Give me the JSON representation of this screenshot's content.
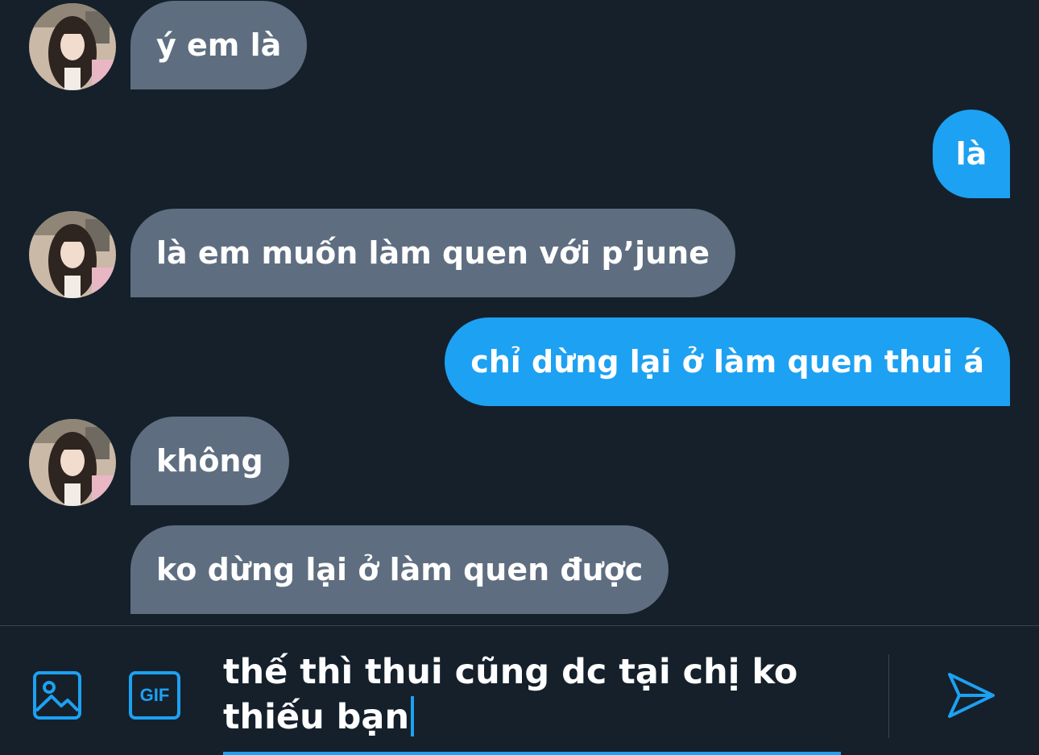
{
  "colors": {
    "background": "#15202b",
    "incoming_bubble": "#5e6e80",
    "outgoing_bubble": "#1da1f2",
    "accent": "#1da1f2",
    "divider": "#38444d"
  },
  "messages": [
    {
      "direction": "incoming",
      "text": "ý em là",
      "show_avatar": true
    },
    {
      "direction": "outgoing",
      "text": "là"
    },
    {
      "direction": "incoming",
      "text": "là em muốn làm quen với p’june",
      "show_avatar": true
    },
    {
      "direction": "outgoing",
      "text": "chỉ dừng lại ở làm quen thui á"
    },
    {
      "direction": "incoming",
      "text": "không",
      "show_avatar": true
    },
    {
      "direction": "incoming",
      "text": "ko dừng lại ở làm quen được",
      "show_avatar": false
    }
  ],
  "composer": {
    "draft_text": "thế thì thui cũng dc tại chị ko\nthiếu bạn",
    "image_icon": "image-icon",
    "gif_icon": "gif-icon",
    "gif_label": "GIF",
    "send_icon": "send-icon"
  }
}
